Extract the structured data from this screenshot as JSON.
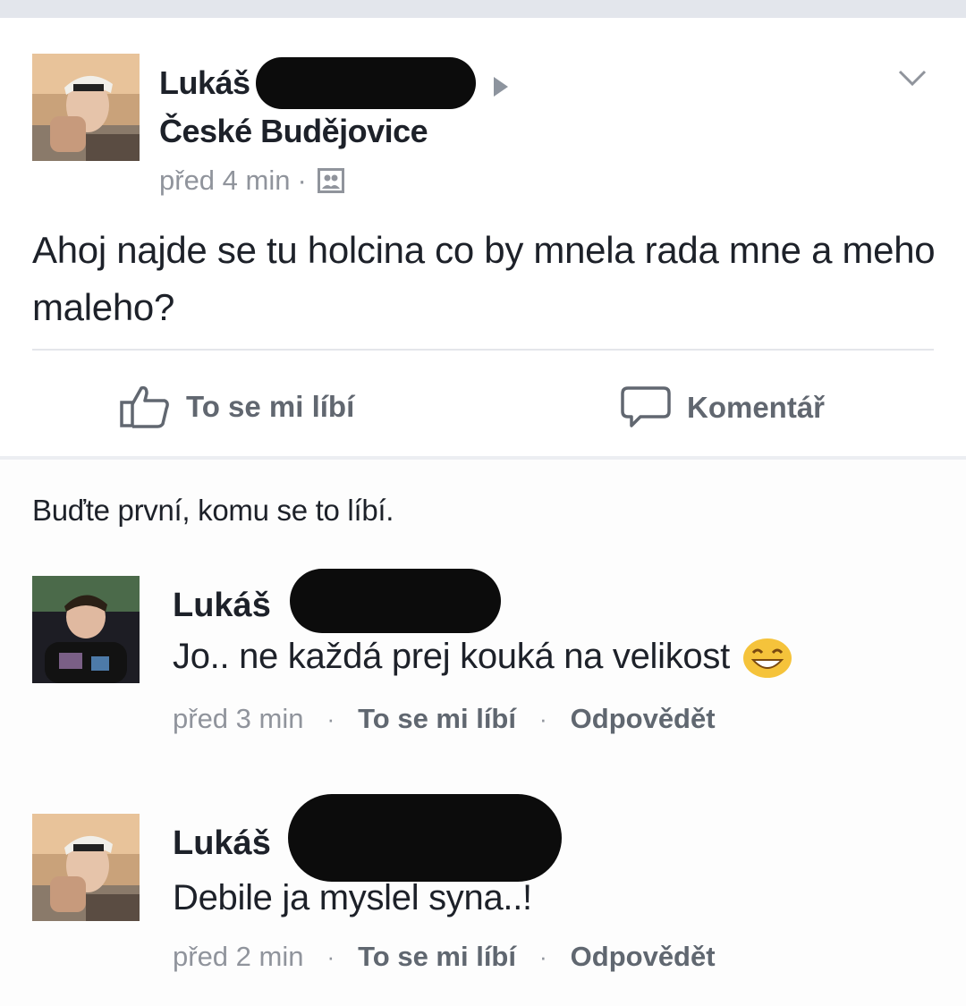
{
  "post": {
    "author": "Lukáš",
    "location": "České Budějovice",
    "time": "před 4 min",
    "separator": "·",
    "text": "Ahoj najde se tu holcina co by mnela rada mne a meho maleho?",
    "actions": {
      "like": "To se mi líbí",
      "comment": "Komentář"
    }
  },
  "likes_text": "Buďte první, komu se to líbí.",
  "comments": [
    {
      "author": "Lukáš",
      "text": "Jo.. ne každá prej kouká na velikost",
      "emoji": "grinning-squint-emoji",
      "time": "před 3 min",
      "like": "To se mi líbí",
      "reply": "Odpovědět",
      "separator": "·"
    },
    {
      "author": "Lukáš",
      "text": "Debile ja myslel syna..!",
      "time": "před 2 min",
      "like": "To se mi líbí",
      "reply": "Odpovědět",
      "separator": "·"
    }
  ],
  "icons": {
    "options": "chevron-down-icon",
    "audience": "friends-icon",
    "like": "thumbs-up-icon",
    "comment": "speech-bubble-icon",
    "post_attachment": "triangle-right-icon"
  },
  "colors": {
    "text": "#1d2129",
    "meta": "#90949c",
    "action": "#616770",
    "emoji": "#f5c33b"
  }
}
